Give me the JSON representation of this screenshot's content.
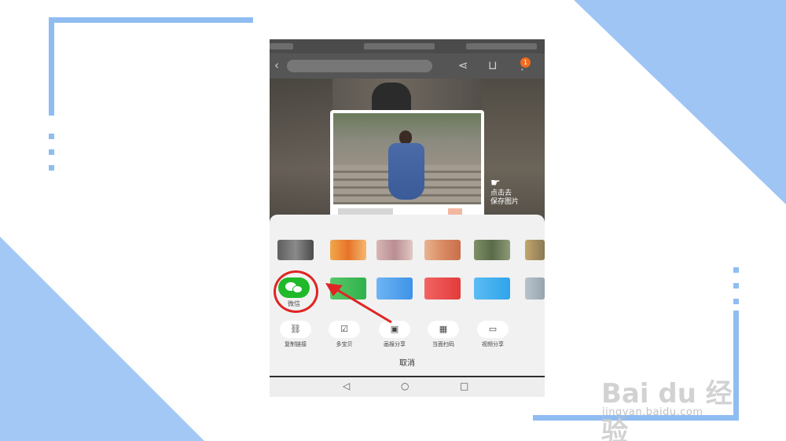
{
  "phone": {
    "badge_count": "1",
    "save_hint": [
      "点击去",
      "保存图片"
    ],
    "share_sheet": {
      "wechat_label": "微信",
      "actions": [
        {
          "label": "复制链接",
          "icon": "link-icon"
        },
        {
          "label": "多宝贝",
          "icon": "multi-item-icon"
        },
        {
          "label": "画报分享",
          "icon": "image-share-icon"
        },
        {
          "label": "当面扫码",
          "icon": "qr-code-icon"
        },
        {
          "label": "视频分享",
          "icon": "video-share-icon"
        }
      ],
      "cancel_label": "取消"
    },
    "nav": {
      "back": "◁",
      "home": "○",
      "recent": "□"
    }
  },
  "watermark": {
    "logo": "Bai du 经验",
    "url": "jingyan.baidu.com"
  },
  "colors": {
    "accent_blue": "#8fbdf2",
    "wechat_green": "#1fb92a",
    "highlight_red": "#e02424"
  }
}
